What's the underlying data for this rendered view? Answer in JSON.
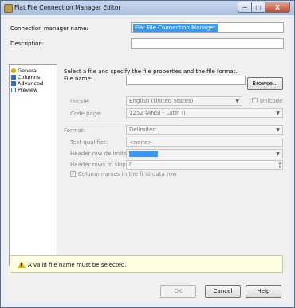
{
  "window": {
    "title": "Flat File Connection Manager Editor",
    "min_glyph": "─",
    "max_glyph": "□",
    "close_glyph": "X"
  },
  "header": {
    "name_label": "Connection manager name:",
    "name_value": "Flat File Connection Manager",
    "description_label": "Description:",
    "description_value": ""
  },
  "nav": {
    "items": [
      {
        "label": "General",
        "icon": "general-icon",
        "color": "#e0b000"
      },
      {
        "label": "Columns",
        "icon": "columns-icon",
        "color": "#3a6fc4"
      },
      {
        "label": "Advanced",
        "icon": "advanced-icon",
        "color": "#3a6fc4"
      },
      {
        "label": "Preview",
        "icon": "preview-icon",
        "color": "#3a6fc4"
      }
    ]
  },
  "general": {
    "instruction": "Select a file and specify the file properties and the file format.",
    "file_name_label": "File name:",
    "file_name_value": "",
    "browse_label": "Browse...",
    "locale_label": "Locale:",
    "locale_value": "English (United States)",
    "unicode_label": "Unicode",
    "code_page_label": "Code page:",
    "code_page_value": "1252  (ANSI - Latin I)",
    "format_label": "Format:",
    "format_value": "Delimited",
    "text_qualifier_label": "Text qualifier:",
    "text_qualifier_value": "<none>",
    "header_row_delimiter_label": "Header row delimiter:",
    "header_rows_skip_label": "Header rows to skip:",
    "header_rows_skip_value": "0",
    "column_names_label": "Column names in the first data row",
    "column_names_checked": "✓"
  },
  "status": {
    "message": "A valid file name must be selected.",
    "warn_glyph": "!"
  },
  "buttons": {
    "ok": "OK",
    "cancel": "Cancel",
    "help": "Help"
  },
  "colors": {
    "selection": "#3399ff",
    "warning": "#e8b50b"
  }
}
